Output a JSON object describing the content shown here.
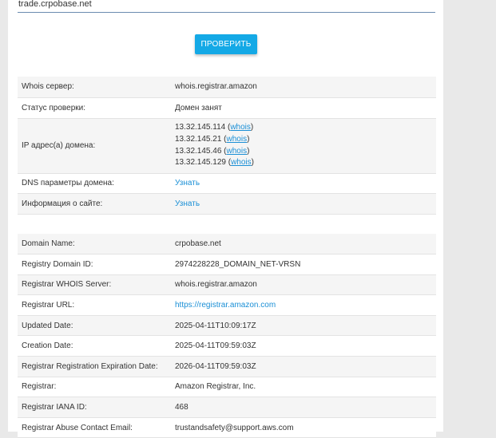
{
  "search": {
    "value": "trade.crpobase.net"
  },
  "check_button_label": "ПРОВЕРИТЬ",
  "info_rows": {
    "whois_server": {
      "label": "Whois сервер:",
      "value": "whois.registrar.amazon"
    },
    "status": {
      "label": "Статус проверки:",
      "value": "Домен занят"
    },
    "ip": {
      "label": "IP адрес(а) домена:",
      "whois_label": "whois",
      "addresses": [
        "13.32.145.114",
        "13.32.145.21",
        "13.32.145.46",
        "13.32.145.129"
      ]
    },
    "dns": {
      "label": "DNS параметры домена:",
      "link": "Узнать"
    },
    "site_info": {
      "label": "Информация о сайте:",
      "link": "Узнать"
    }
  },
  "whois_rows": [
    {
      "label": "Domain Name:",
      "value": "crpobase.net"
    },
    {
      "label": "Registry Domain ID:",
      "value": "2974228228_DOMAIN_NET-VRSN"
    },
    {
      "label": "Registrar WHOIS Server:",
      "value": "whois.registrar.amazon"
    },
    {
      "label": "Registrar URL:",
      "value": "https://registrar.amazon.com",
      "is_link": true
    },
    {
      "label": "Updated Date:",
      "value": "2025-04-11T10:09:17Z"
    },
    {
      "label": "Creation Date:",
      "value": "2025-04-11T09:59:03Z"
    },
    {
      "label": "Registrar Registration Expiration Date:",
      "value": "2026-04-11T09:59:03Z"
    },
    {
      "label": "Registrar:",
      "value": "Amazon Registrar, Inc."
    },
    {
      "label": "Registrar IANA ID:",
      "value": "468"
    },
    {
      "label": "Registrar Abuse Contact Email:",
      "value": "trustandsafety@support.aws.com"
    }
  ],
  "colors": {
    "accent": "#14a9e6",
    "link": "#1a8fd6",
    "row_alt": "#f5f5f5",
    "page_bg": "#e9e9e9"
  }
}
